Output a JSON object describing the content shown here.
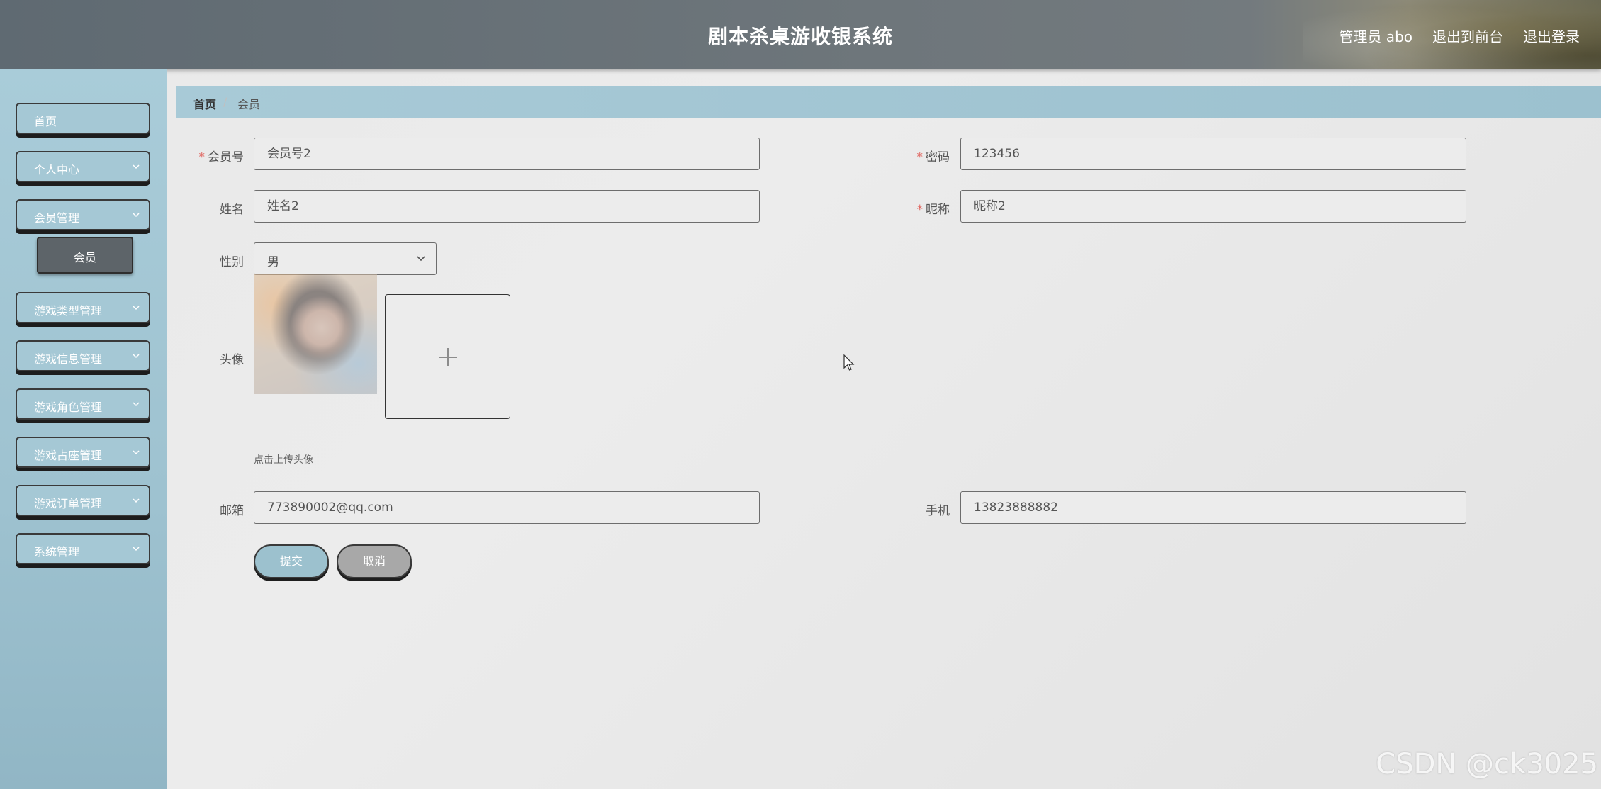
{
  "header": {
    "title": "剧本杀桌游收银系统",
    "user_label": "管理员 abo",
    "front_link": "退出到前台",
    "logout_link": "退出登录"
  },
  "sidebar": {
    "items": [
      {
        "label": "首页",
        "has_children": false
      },
      {
        "label": "个人中心",
        "has_children": true
      },
      {
        "label": "会员管理",
        "has_children": true,
        "expanded": true
      },
      {
        "label": "游戏类型管理",
        "has_children": true
      },
      {
        "label": "游戏信息管理",
        "has_children": true
      },
      {
        "label": "游戏角色管理",
        "has_children": true
      },
      {
        "label": "游戏占座管理",
        "has_children": true
      },
      {
        "label": "游戏订单管理",
        "has_children": true
      },
      {
        "label": "系统管理",
        "has_children": true
      }
    ],
    "active_sub_item": "会员"
  },
  "breadcrumb": {
    "home": "首页",
    "separator": "/",
    "current": "会员"
  },
  "form": {
    "member_no": {
      "label": "会员号",
      "value": "会员号2",
      "required": true
    },
    "password": {
      "label": "密码",
      "value": "123456",
      "required": true
    },
    "name": {
      "label": "姓名",
      "value": "姓名2",
      "required": false
    },
    "nickname": {
      "label": "昵称",
      "value": "昵称2",
      "required": true
    },
    "gender": {
      "label": "性别",
      "value": "男"
    },
    "avatar": {
      "label": "头像",
      "tip": "点击上传头像"
    },
    "email": {
      "label": "邮箱",
      "value": "773890002@qq.com"
    },
    "phone": {
      "label": "手机",
      "value": "13823888882"
    },
    "required_mark": "*"
  },
  "buttons": {
    "submit": "提交",
    "cancel": "取消"
  },
  "watermark": "CSDN @ck3025",
  "colors": {
    "header_bg": "#6e767b",
    "sidebar_bg": "#a9ccd9",
    "submit_bg": "#9cc1ce",
    "cancel_bg": "#a8a8a8",
    "active_sub_bg": "#5d6469",
    "required": "#e0605a"
  },
  "icons": {
    "menu_expand": "chevron-down-icon",
    "select": "chevron-down-icon",
    "upload": "plus-icon"
  }
}
